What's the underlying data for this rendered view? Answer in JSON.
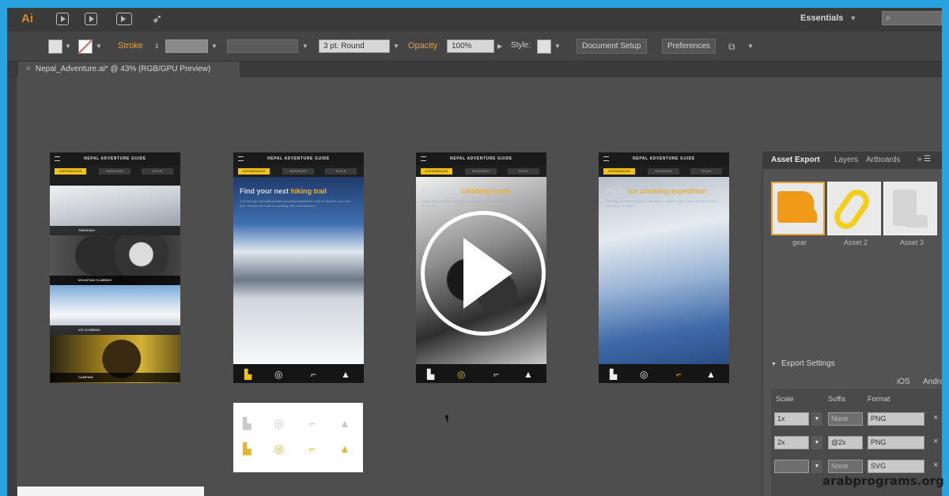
{
  "app": {
    "logo": "Ai",
    "workspace": "Essentials",
    "search_placeholder": ""
  },
  "control_bar": {
    "stroke_label": "Stroke",
    "brush": "3 pt. Round",
    "opacity_label": "Opacity",
    "opacity_value": "100%",
    "style_label": "Style:",
    "document_setup": "Document Setup",
    "preferences": "Preferences"
  },
  "document_tab": {
    "title": "Nepal_Adventure.ai* @ 43% (RGB/GPU Preview)"
  },
  "artboards": [
    {
      "header": "NEPAL ADVENTURE GUIDE",
      "tabs": [
        "EXPERIENCES",
        "RESERVES",
        "STYLE"
      ],
      "captions": [
        "TREKKING",
        "MOUNTAIN CLIMBING",
        "ICE CLIMBING",
        "CAMPING"
      ]
    },
    {
      "header": "NEPAL ADVENTURE GUIDE",
      "tabs": [
        "EXPERIENCES",
        "RESERVES",
        "STYLE"
      ],
      "hero_title_pre": "Find your next ",
      "hero_title_hl": "hiking trail",
      "hero_text": "Trek through mountain passes including established trails or discover your own path. Explore the route for spotting, film, and sketches."
    },
    {
      "header": "NEPAL ADVENTURE GUIDE",
      "tabs": [
        "EXPERIENCES",
        "RESERVES",
        "STYLE"
      ],
      "hero_title_pre": "Scout your ",
      "hero_title_hl": "climbing route",
      "hero_text": "Begin with a planned expedition or select a custom route. Find the peak you want to summit."
    },
    {
      "header": "NEPAL ADVENTURE GUIDE",
      "tabs": [
        "EXPERIENCES",
        "RESERVES",
        "STYLE"
      ],
      "hero_title_pre": "Try an ",
      "hero_title_hl": "ice climbing expedition",
      "hero_text": "Challenge yourself on frozen waterfalls and glaciers with a guide and pick from a wide range of routes."
    }
  ],
  "panel": {
    "tabs": [
      "Asset Export",
      "Layers",
      "Artboards"
    ],
    "assets": [
      {
        "name": "gear"
      },
      {
        "name": "Asset 2"
      },
      {
        "name": "Asset 3"
      }
    ],
    "export_settings": "Export Settings",
    "platforms": [
      "iOS",
      "Android"
    ],
    "columns": [
      "Scale",
      "Suffix",
      "Format"
    ],
    "rows": [
      {
        "scale": "1x",
        "suffix": "None",
        "format": "PNG"
      },
      {
        "scale": "2x",
        "suffix": "@2x",
        "format": "PNG"
      },
      {
        "scale": "",
        "suffix": "None",
        "format": "SVG"
      }
    ]
  },
  "watermark": "arabprograms.org"
}
